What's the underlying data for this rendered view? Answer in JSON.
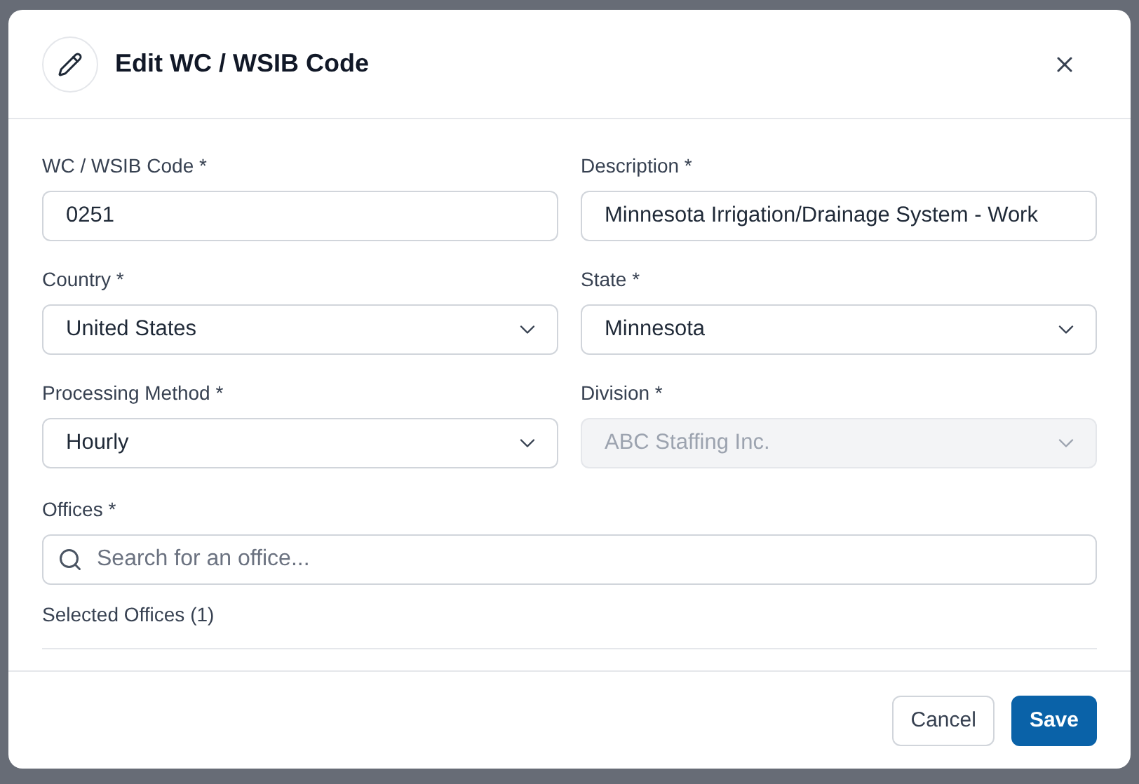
{
  "dialog": {
    "title": "Edit WC / WSIB Code"
  },
  "fields": [
    {
      "kind": "text",
      "label": "WC / WSIB Code *",
      "value": "0251",
      "disabled": false
    },
    {
      "kind": "text",
      "label": "Description *",
      "value": "Minnesota Irrigation/Drainage System - Work",
      "disabled": false
    },
    {
      "kind": "select",
      "label": "Country *",
      "value": "United States",
      "disabled": false
    },
    {
      "kind": "select",
      "label": "State *",
      "value": "Minnesota",
      "disabled": false
    },
    {
      "kind": "select",
      "label": "Processing Method *",
      "value": "Hourly",
      "disabled": false
    },
    {
      "kind": "select",
      "label": "Division *",
      "value": "ABC Staffing Inc.",
      "disabled": true
    }
  ],
  "offices": {
    "label": "Offices *",
    "placeholder": "Search for an office...",
    "selected_label": "Selected Offices (1)"
  },
  "buttons": [
    {
      "kind": "secondary",
      "label": "Cancel"
    },
    {
      "kind": "primary",
      "label": "Save"
    }
  ]
}
